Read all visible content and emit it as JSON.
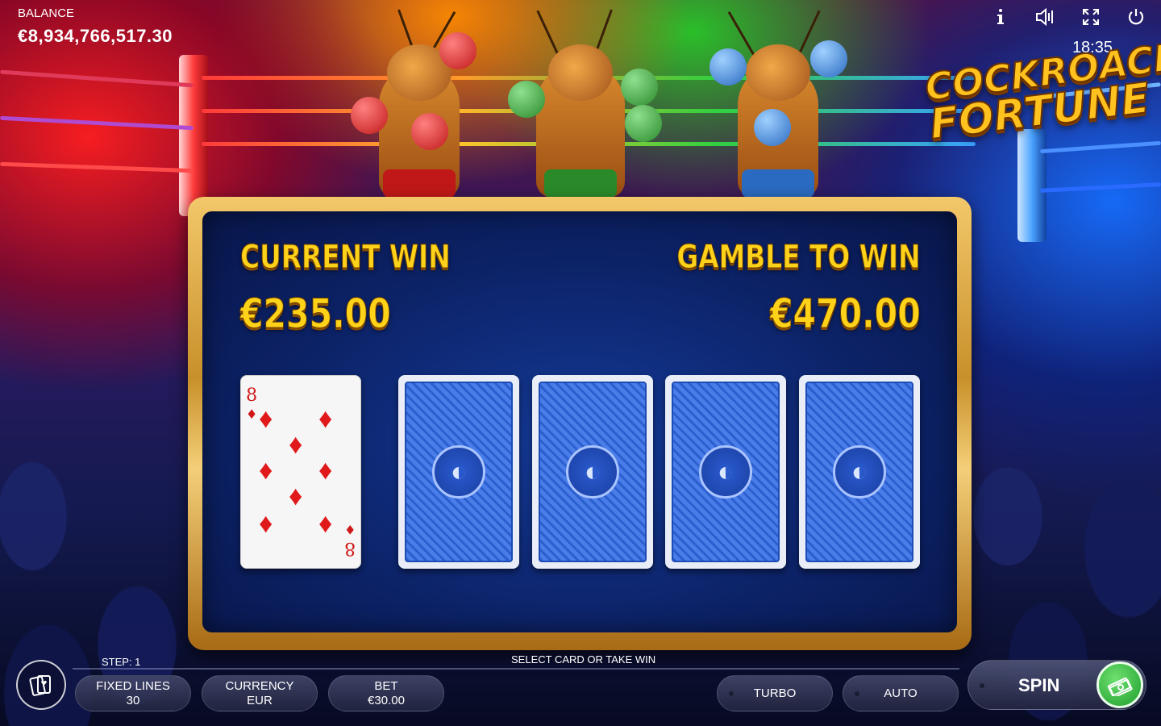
{
  "hud": {
    "balance_label": "BALANCE",
    "balance_value": "€8,934,766,517.30",
    "clock": "18:35",
    "icons": [
      "info-icon",
      "sound-icon",
      "fullscreen-icon",
      "power-icon"
    ]
  },
  "logo": {
    "line1": "COCKROACH",
    "line2": "FORTUNE"
  },
  "gamble": {
    "current_win_label": "CURRENT WIN",
    "current_win_value": "€235.00",
    "gamble_to_win_label": "GAMBLE TO WIN",
    "gamble_to_win_value": "€470.00",
    "dealer_card": {
      "rank": "8",
      "suit": "♦",
      "suit_name": "diamonds"
    },
    "face_down_cards": 4
  },
  "bottom": {
    "step": "STEP: 1",
    "hint": "SELECT CARD OR TAKE WIN",
    "fixed_lines_label": "FIXED LINES",
    "fixed_lines_value": "30",
    "currency_label": "CURRENCY",
    "currency_value": "EUR",
    "bet_label": "BET",
    "bet_value": "€30.00",
    "turbo_label": "TURBO",
    "auto_label": "AUTO",
    "spin_label": "SPIN"
  },
  "colors": {
    "gold": "#ffd21a",
    "panel_blue": "#0c2266",
    "card_back_blue": "#2b5fd0",
    "diamond_red": "#e01a1a",
    "cash_green": "#1e9e2e"
  }
}
